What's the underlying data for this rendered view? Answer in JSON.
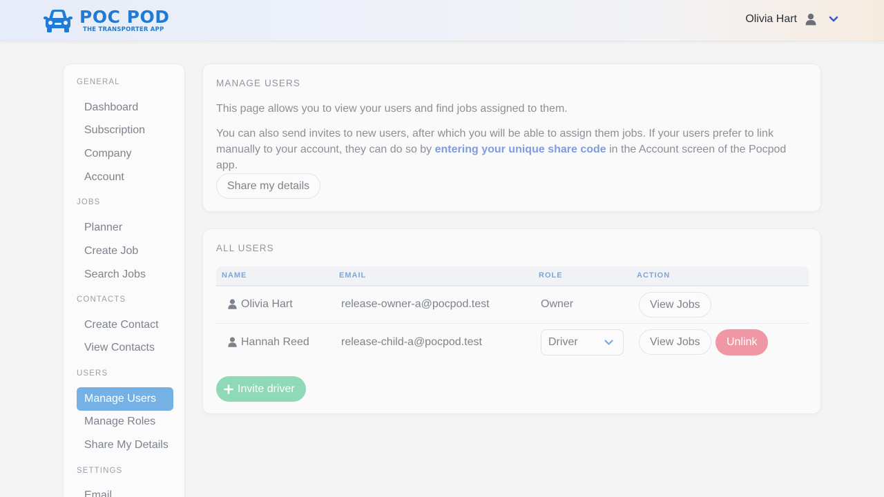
{
  "brand": {
    "title": "POC POD",
    "subtitle": "THE TRANSPORTER APP",
    "color": "#1f7bd6"
  },
  "header": {
    "user_name": "Olivia Hart",
    "user_icon": "user-icon",
    "menu_icon": "chevron-down-icon"
  },
  "sidebar": {
    "sections": [
      {
        "label": "GENERAL",
        "items": [
          "Dashboard",
          "Subscription",
          "Company",
          "Account"
        ]
      },
      {
        "label": "JOBS",
        "items": [
          "Planner",
          "Create Job",
          "Search Jobs"
        ]
      },
      {
        "label": "CONTACTS",
        "items": [
          "Create Contact",
          "View Contacts"
        ]
      },
      {
        "label": "USERS",
        "items": [
          "Manage Users",
          "Manage Roles",
          "Share My Details"
        ]
      },
      {
        "label": "SETTINGS",
        "items": [
          "Email"
        ]
      }
    ],
    "active_item": "Manage Users"
  },
  "manage_users": {
    "title": "MANAGE USERS",
    "para1": "This page allows you to view your users and find jobs assigned to them.",
    "para2_before": "You can also send invites to new users, after which you will be able to assign them jobs. If your users prefer to link manually to your account, they can do so by ",
    "para2_link": "entering your unique share code",
    "para2_after": " in the Account screen of the Pocpod app.",
    "share_button": "Share my details"
  },
  "all_users": {
    "title": "ALL USERS",
    "columns": [
      "NAME",
      "EMAIL",
      "ROLE",
      "ACTION"
    ],
    "rows": [
      {
        "name": "Olivia Hart",
        "email": "release-owner-a@pocpod.test",
        "role": "Owner",
        "view_jobs": "View Jobs"
      },
      {
        "name": "Hannah Reed",
        "email": "release-child-a@pocpod.test",
        "role": "Driver",
        "view_jobs": "View Jobs",
        "unlink": "Unlink"
      }
    ],
    "invite_button": "Invite driver"
  },
  "colors": {
    "active_nav": "#76b1e6",
    "unlink": "#f097a5",
    "invite": "#8fd8b8",
    "link": "#7f9ce0"
  }
}
